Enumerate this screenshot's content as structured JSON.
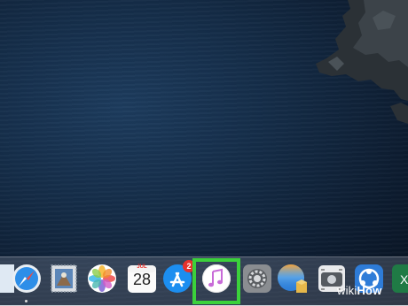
{
  "desktop": {
    "wallpaper": "ocean-cliffs"
  },
  "dock": {
    "items": [
      {
        "name": "finder-partial",
        "icon": "finder-icon"
      },
      {
        "name": "safari",
        "icon": "safari-compass-icon"
      },
      {
        "name": "mail",
        "icon": "mail-stamp-icon"
      },
      {
        "name": "photos",
        "icon": "photos-flower-icon"
      },
      {
        "name": "calendar",
        "icon": "calendar-icon",
        "month": "JUL",
        "day": "28"
      },
      {
        "name": "app-store",
        "icon": "app-store-icon",
        "badge": "2"
      },
      {
        "name": "itunes",
        "icon": "music-note-icon",
        "highlighted": true
      },
      {
        "name": "system-preferences",
        "icon": "gear-icon"
      },
      {
        "name": "macos-installer",
        "icon": "installer-icon"
      },
      {
        "name": "screenshot",
        "icon": "camera-icon"
      },
      {
        "name": "sourcetree",
        "icon": "share-icon"
      },
      {
        "name": "excel-partial",
        "icon": "excel-icon",
        "letter": "X"
      }
    ]
  },
  "watermark": {
    "part1": "wiki",
    "part2": "How"
  },
  "colors": {
    "highlight": "#3bd13b",
    "badge": "#e5322d",
    "itunes_note": "#c86bd8"
  }
}
